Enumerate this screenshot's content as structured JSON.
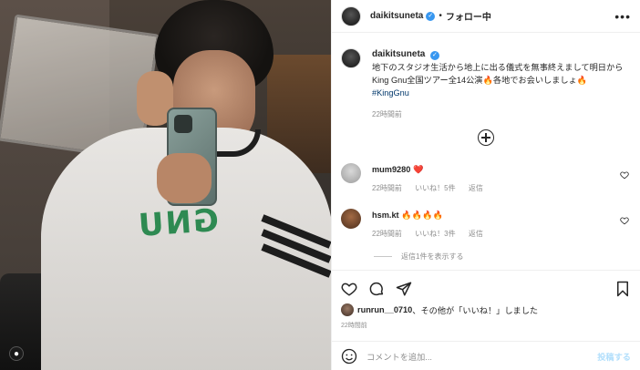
{
  "header": {
    "username": "daikitsuneta",
    "separator": "•",
    "follow_status": "フォロー中",
    "more": "•••"
  },
  "caption": {
    "username": "daikitsuneta",
    "text": "地下のスタジオ生活から地上に出る儀式を無事終えまして明日からKing Gnu全国ツアー全14公演🔥各地でお会いしましょ🔥",
    "hashtag": "#KingGnu",
    "time": "22時間前"
  },
  "comments": [
    {
      "username": "mum9280",
      "text": "❤️",
      "time": "22時間前",
      "likes": "いいね！5件",
      "reply": "返信"
    },
    {
      "username": "hsm.kt",
      "text": "🔥🔥🔥🔥",
      "time": "22時間前",
      "likes": "いいね！3件",
      "reply": "返信"
    }
  ],
  "view_replies": "返信1件を表示する",
  "likes_line": {
    "user": "runrun__0710",
    "rest": "、その他が「いいね！」しました"
  },
  "post_time": "22時間前",
  "comment_input": {
    "placeholder": "コメントを追加...",
    "post_label": "投稿する"
  },
  "photo": {
    "logo_text": "GNU"
  },
  "colors": {
    "verified": "#3897f0",
    "hashtag": "#00376b",
    "muted": "#8e8e8e",
    "post_disabled": "#b2dffc"
  }
}
